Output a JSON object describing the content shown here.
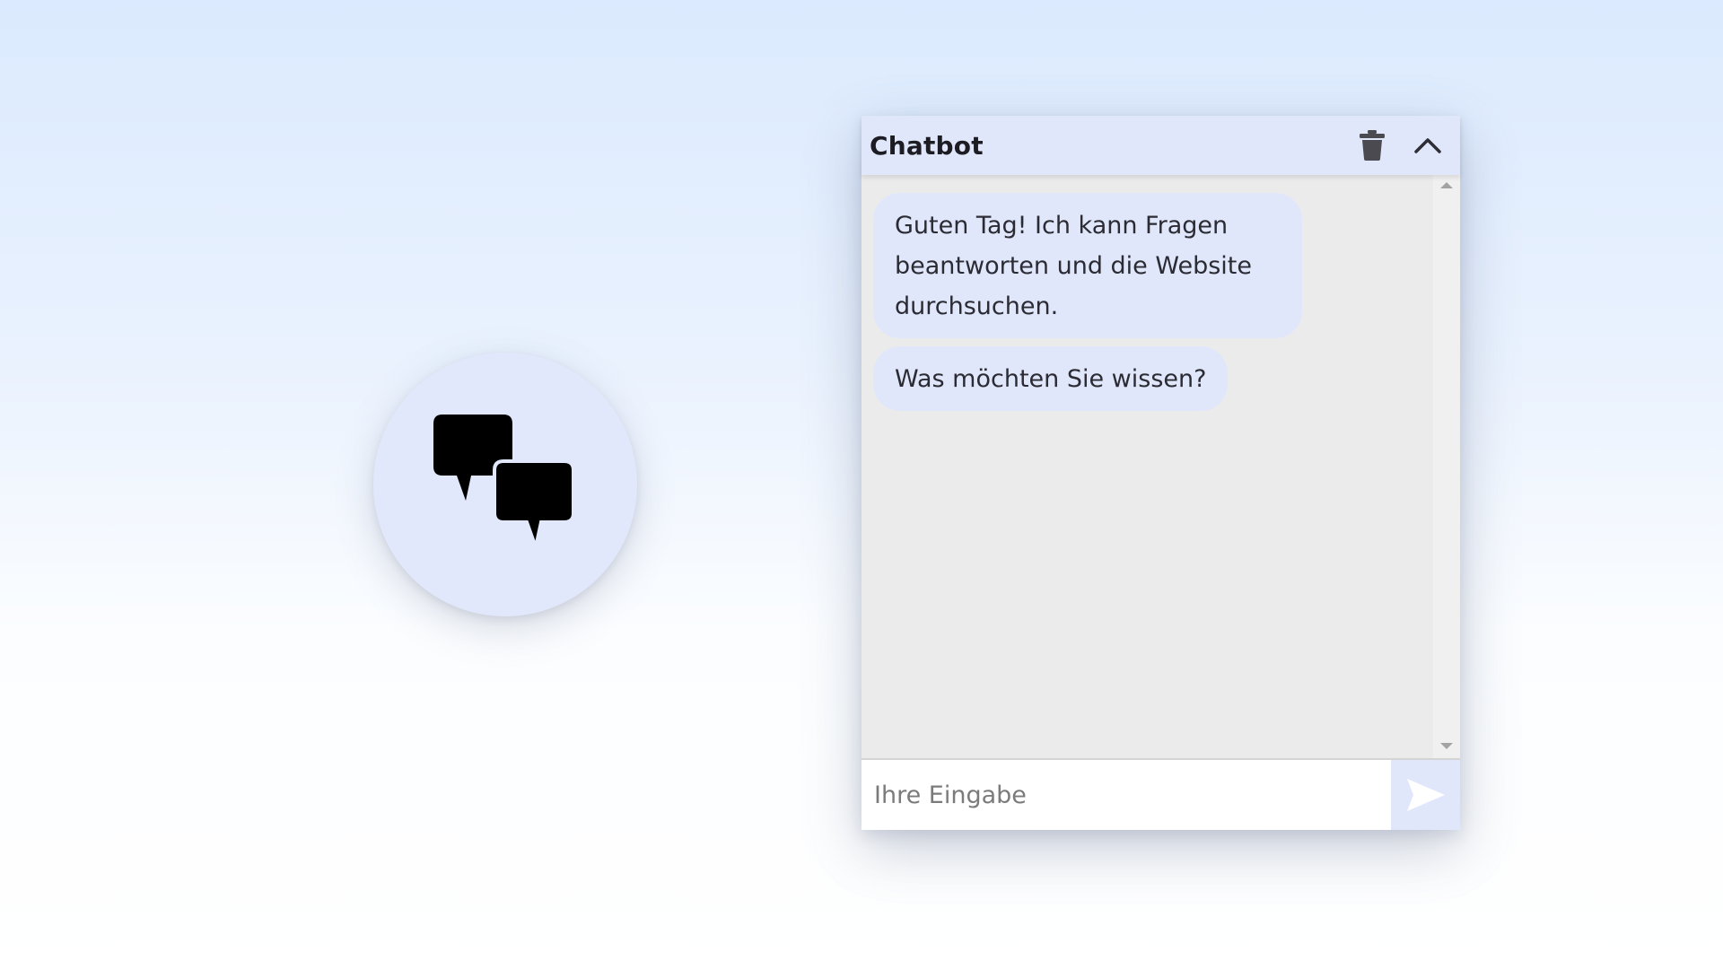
{
  "launcher": {
    "icon": "chat-bubbles-icon"
  },
  "chat": {
    "title": "Chatbot",
    "header_icons": [
      "trash-icon",
      "chevron-up-icon"
    ],
    "messages": [
      {
        "sender": "bot",
        "text": "Guten Tag! Ich kann Fragen beantworten und die Website durchsuchen."
      },
      {
        "sender": "bot",
        "text": "Was möchten Sie wissen?"
      }
    ],
    "input": {
      "value": "",
      "placeholder": "Ihre Eingabe"
    },
    "send_icon": "send-icon"
  },
  "colors": {
    "bubble": "#e1e7fb",
    "header": "#e1e7fb",
    "chat_background": "#ebebeb",
    "send_icon": "#ffffff"
  }
}
